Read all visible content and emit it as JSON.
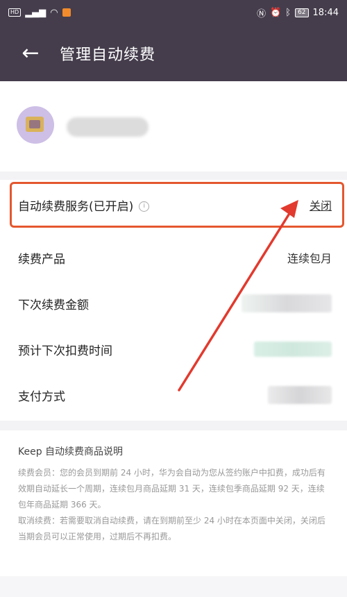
{
  "status_bar": {
    "hd_badge": "HD",
    "battery": "62",
    "time": "18:44"
  },
  "header": {
    "title": "管理自动续费"
  },
  "auto_renew": {
    "label": "自动续费服务(已开启)",
    "close_label": "关闭"
  },
  "rows": [
    {
      "label": "续费产品",
      "value": "连续包月"
    },
    {
      "label": "下次续费金额"
    },
    {
      "label": "预计下次扣费时间"
    },
    {
      "label": "支付方式"
    }
  ],
  "description": {
    "title": "Keep 自动续费商品说明",
    "paragraphs": [
      "续费会员：您的会员到期前 24 小时，华为会自动为您从签约账户中扣费，成功后有效期自动延长一个周期，连续包月商品延期 31 天，连续包季商品延期 92 天，连续包年商品延期 366 天。",
      "取消续费：若需要取消自动续费，请在到期前至少 24 小时在本页面中关闭，关闭后当期会员可以正常使用，过期后不再扣费。"
    ]
  },
  "colors": {
    "header_bg": "#453d4c",
    "highlight_border": "#e4572e",
    "annotation_arrow": "#e23a2e"
  }
}
